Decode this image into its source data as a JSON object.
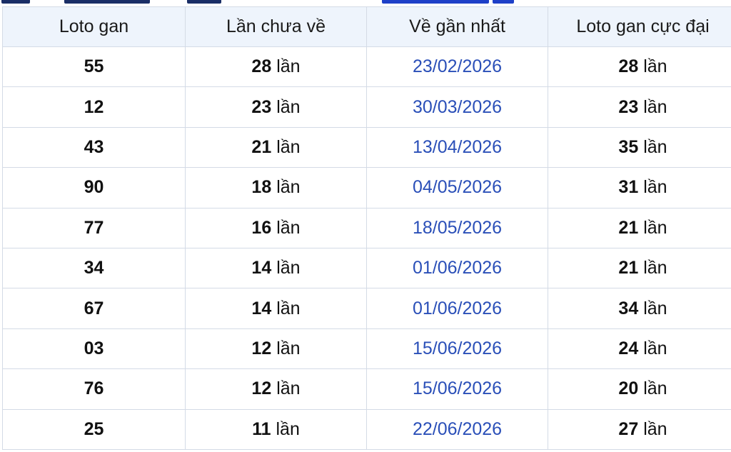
{
  "table": {
    "headers": [
      "Loto gan",
      "Lần chưa về",
      "Về gần nhất",
      "Loto gan cực đại"
    ],
    "unit": "lần",
    "rows": [
      {
        "loto": "55",
        "missed": "28",
        "last_date": "23/02/2026",
        "max_gan": "28"
      },
      {
        "loto": "12",
        "missed": "23",
        "last_date": "30/03/2026",
        "max_gan": "23"
      },
      {
        "loto": "43",
        "missed": "21",
        "last_date": "13/04/2026",
        "max_gan": "35"
      },
      {
        "loto": "90",
        "missed": "18",
        "last_date": "04/05/2026",
        "max_gan": "31"
      },
      {
        "loto": "77",
        "missed": "16",
        "last_date": "18/05/2026",
        "max_gan": "21"
      },
      {
        "loto": "34",
        "missed": "14",
        "last_date": "01/06/2026",
        "max_gan": "21"
      },
      {
        "loto": "67",
        "missed": "14",
        "last_date": "01/06/2026",
        "max_gan": "34"
      },
      {
        "loto": "03",
        "missed": "12",
        "last_date": "15/06/2026",
        "max_gan": "24"
      },
      {
        "loto": "76",
        "missed": "12",
        "last_date": "15/06/2026",
        "max_gan": "20"
      },
      {
        "loto": "25",
        "missed": "11",
        "last_date": "22/06/2026",
        "max_gan": "27"
      }
    ]
  },
  "colors": {
    "header_bg": "#eef4fc",
    "border": "#d4dbe6",
    "date_link": "#2a4fb8",
    "heading_dark": "#1a2e66",
    "heading_blue": "#1e40c8"
  }
}
